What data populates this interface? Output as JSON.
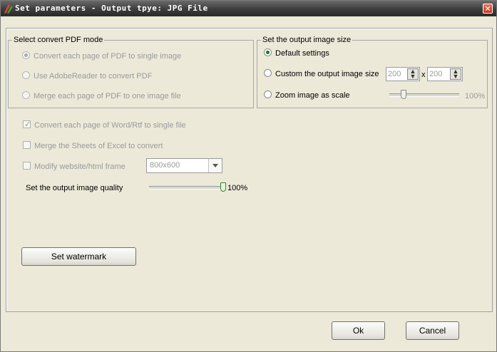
{
  "window": {
    "title": "Set parameters - Output tpye: JPG File",
    "close_glyph": "✕"
  },
  "pdf_mode": {
    "label": "Select convert PDF mode",
    "options": [
      {
        "label": "Convert each page of PDF to single image",
        "selected": true
      },
      {
        "label": "Use AdobeReader to convert PDF",
        "selected": false
      },
      {
        "label": "Merge each page of PDF to one image file",
        "selected": false
      }
    ]
  },
  "image_size": {
    "label": "Set the output image size",
    "default_label": "Default settings",
    "custom_label": "Custom the output image size",
    "width_value": "200",
    "height_value": "200",
    "times": "x",
    "zoom_label": "Zoom image as scale",
    "zoom_percent": "100%",
    "zoom_level": 0.2,
    "selected": "default"
  },
  "options": {
    "word_rtf": "Convert each page of Word/Rtf to single file",
    "excel": "Merge the Sheets of Excel to convert",
    "website_frame": "Modify website/html frame",
    "frame_value": "800x600",
    "quality_label": "Set the output image quality",
    "quality_percent": "100%",
    "quality_level": 1.0
  },
  "buttons": {
    "watermark": "Set watermark",
    "ok": "Ok",
    "cancel": "Cancel"
  }
}
